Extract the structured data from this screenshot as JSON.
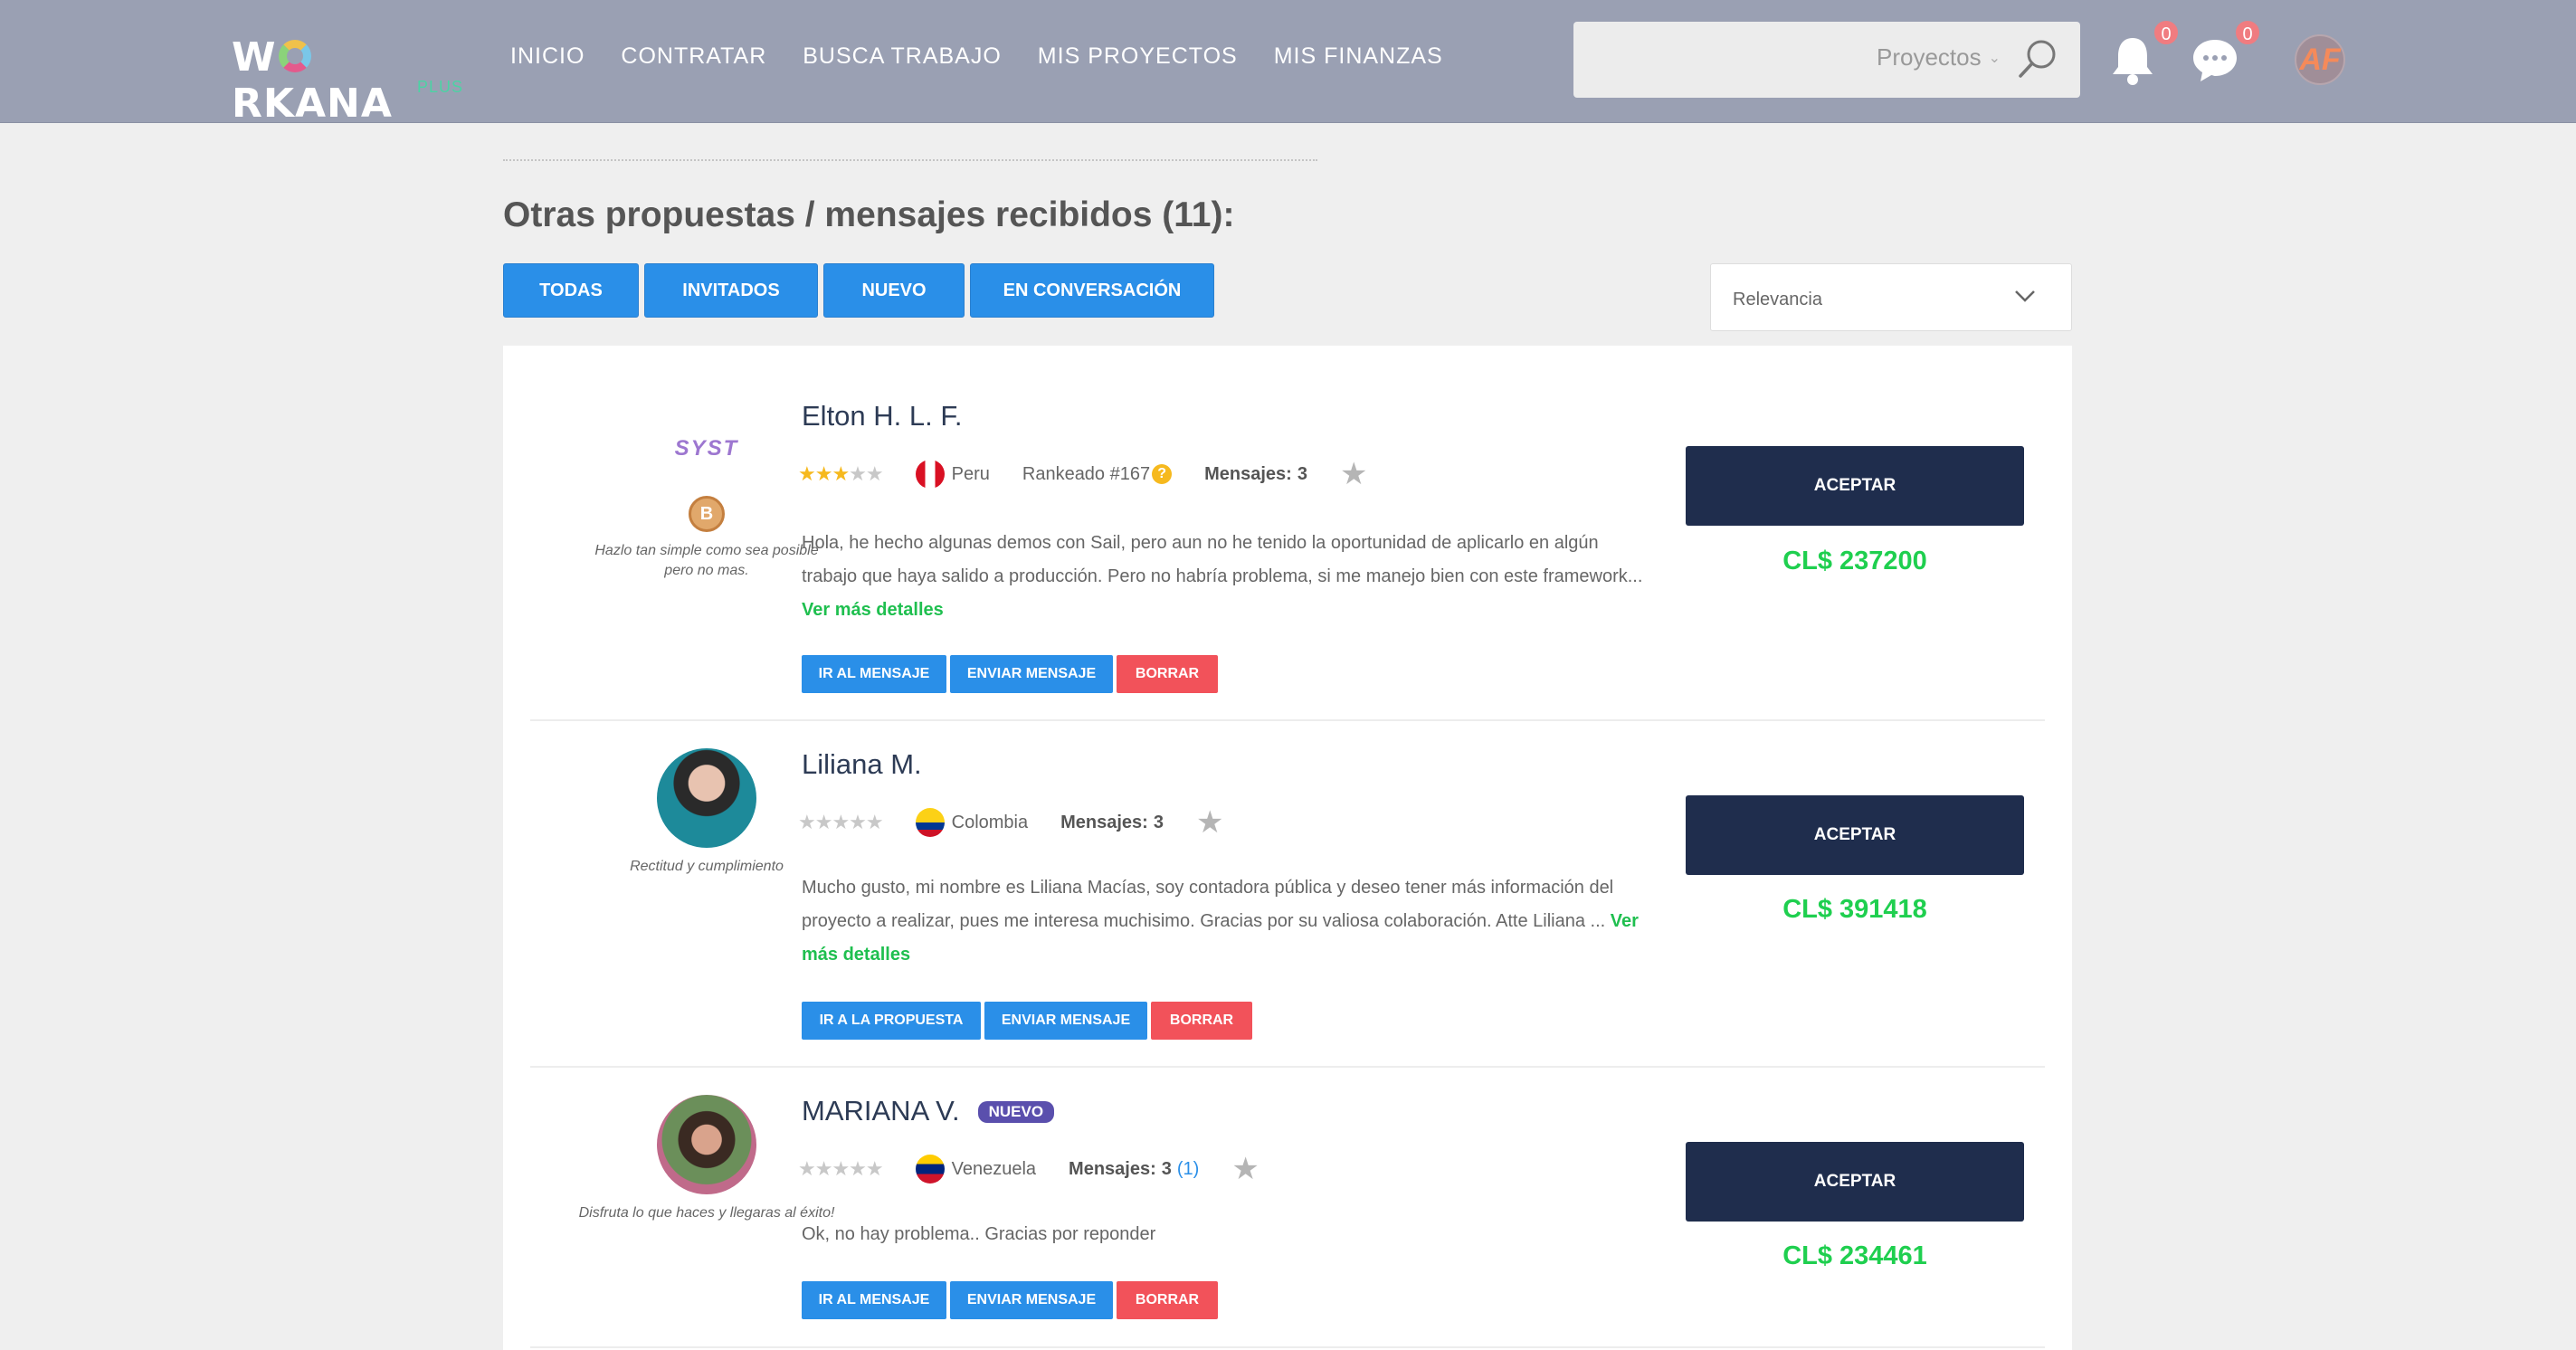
{
  "header": {
    "logo_text": "WORKANA",
    "logo_sub": "PLUS",
    "nav": [
      "INICIO",
      "CONTRATAR",
      "BUSCA TRABAJO",
      "MIS PROYECTOS",
      "MIS FINANZAS"
    ],
    "search": {
      "scope": "Proyectos",
      "placeholder": ""
    },
    "notifications_count": "0",
    "messages_count": "0",
    "user_initials": "AF"
  },
  "page": {
    "title": "Otras propuestas / mensajes recibidos (11):",
    "filters": [
      "TODAS",
      "INVITADOS",
      "NUEVO",
      "EN CONVERSACIÓN"
    ],
    "sort": {
      "selected": "Relevancia"
    }
  },
  "proposals": [
    {
      "name": "Elton H. L. F.",
      "logo_text": "SYST",
      "medal": "B",
      "quote": "Hazlo tan simple como sea posible pero no mas.",
      "rating": 3,
      "country": "Peru",
      "rank": "Rankeado #167",
      "messages_label": "Mensajes:",
      "messages_count": "3",
      "description": "Hola, he hecho algunas demos con Sail, pero aun no he tenido la oportunidad de aplicarlo en algún trabajo que haya salido a producción. Pero no habría problema, si me manejo bien con este framework...",
      "more": "Ver más detalles",
      "actions": [
        "IR AL MENSAJE",
        "ENVIAR MENSAJE",
        "BORRAR"
      ],
      "accept": "ACEPTAR",
      "price": "CL$ 237200"
    },
    {
      "name": "Liliana M.",
      "quote": "Rectitud y cumplimiento",
      "rating": 0,
      "country": "Colombia",
      "messages_label": "Mensajes:",
      "messages_count": "3",
      "description": "Mucho gusto, mi nombre es Liliana Macías, soy contadora pública y deseo tener más información del proyecto a realizar, pues me interesa muchisimo. Gracias por su valiosa colaboración. Atte Liliana ...",
      "more": "Ver más detalles",
      "actions": [
        "IR A LA PROPUESTA",
        "ENVIAR MENSAJE",
        "BORRAR"
      ],
      "accept": "ACEPTAR",
      "price": "CL$ 391418"
    },
    {
      "name": "MARIANA V.",
      "badge": "NUEVO",
      "quote": "Disfruta lo que haces y llegaras al éxito!",
      "rating": 0,
      "country": "Venezuela",
      "messages_label": "Mensajes:",
      "messages_count": "3",
      "unread": "(1)",
      "description": "Ok, no hay problema.. Gracias por reponder",
      "actions": [
        "IR AL MENSAJE",
        "ENVIAR MENSAJE",
        "BORRAR"
      ],
      "accept": "ACEPTAR",
      "price": "CL$ 234461"
    }
  ],
  "colors": {
    "header_bg": "#9aa0b3",
    "primary_blue": "#2a8fe8",
    "danger_red": "#f2525a",
    "accept_navy": "#1f2d4d",
    "price_green": "#1fcf4f"
  }
}
